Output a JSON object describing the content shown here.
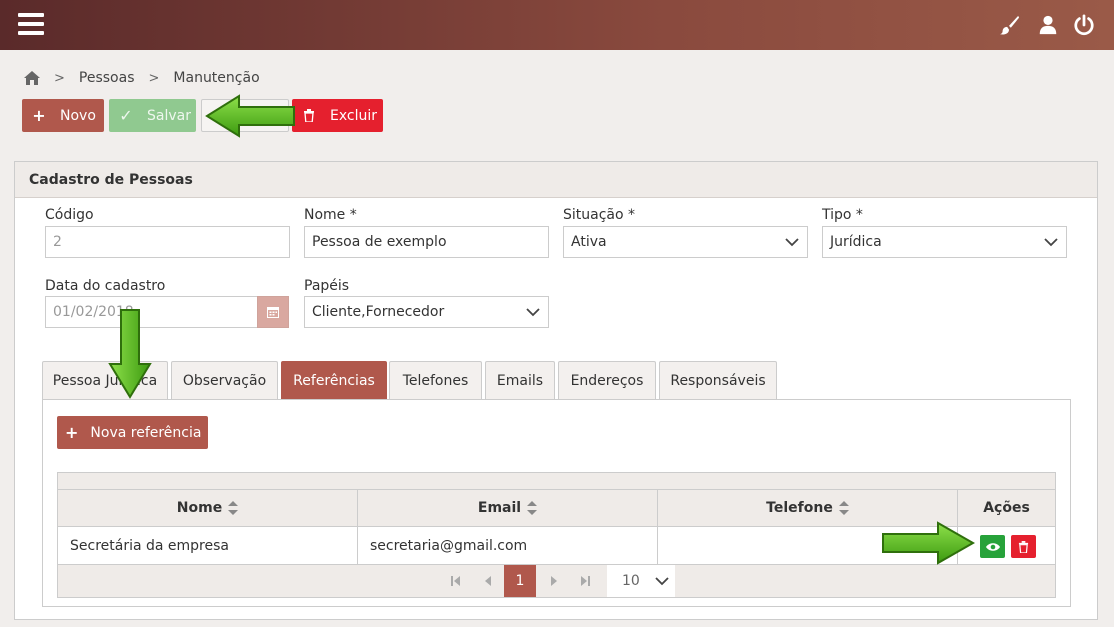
{
  "header": {
    "menu_icon": "hamburger-menu-icon",
    "icons": [
      "paintbrush-icon",
      "user-icon",
      "power-icon"
    ]
  },
  "breadcrumb": {
    "home_icon": "home-icon",
    "items": [
      "Pessoas",
      "Manutenção"
    ]
  },
  "toolbar": {
    "novo_label": "Novo",
    "salvar_label": "Salvar",
    "excluir_label": "Excluir"
  },
  "panel": {
    "title": "Cadastro de Pessoas",
    "fields": {
      "codigo": {
        "label": "Código",
        "value": "2"
      },
      "nome": {
        "label": "Nome *",
        "value": "Pessoa de exemplo"
      },
      "situacao": {
        "label": "Situação *",
        "value": "Ativa"
      },
      "tipo": {
        "label": "Tipo *",
        "value": "Jurídica"
      },
      "data_cadastro": {
        "label": "Data do cadastro",
        "value": "01/02/2018"
      },
      "papeis": {
        "label": "Papéis",
        "value": "Cliente,Fornecedor"
      }
    }
  },
  "tabs": [
    {
      "label": "Pessoa Jurídica"
    },
    {
      "label": "Observação"
    },
    {
      "label": "Referências",
      "active": true
    },
    {
      "label": "Telefones"
    },
    {
      "label": "Emails"
    },
    {
      "label": "Endereços"
    },
    {
      "label": "Responsáveis"
    }
  ],
  "referencias": {
    "add_button_label": "Nova referência",
    "columns": [
      "Nome",
      "Email",
      "Telefone",
      "Ações"
    ],
    "rows": [
      {
        "nome": "Secretária da empresa",
        "email": "secretaria@gmail.com",
        "telefone": ""
      }
    ],
    "pager": {
      "current_page": "1",
      "page_size": "10"
    }
  },
  "colors": {
    "accent": "#b0584c",
    "success": "#27a23a",
    "danger": "#e5202e",
    "annotation_arrow": "#5fc41a"
  }
}
